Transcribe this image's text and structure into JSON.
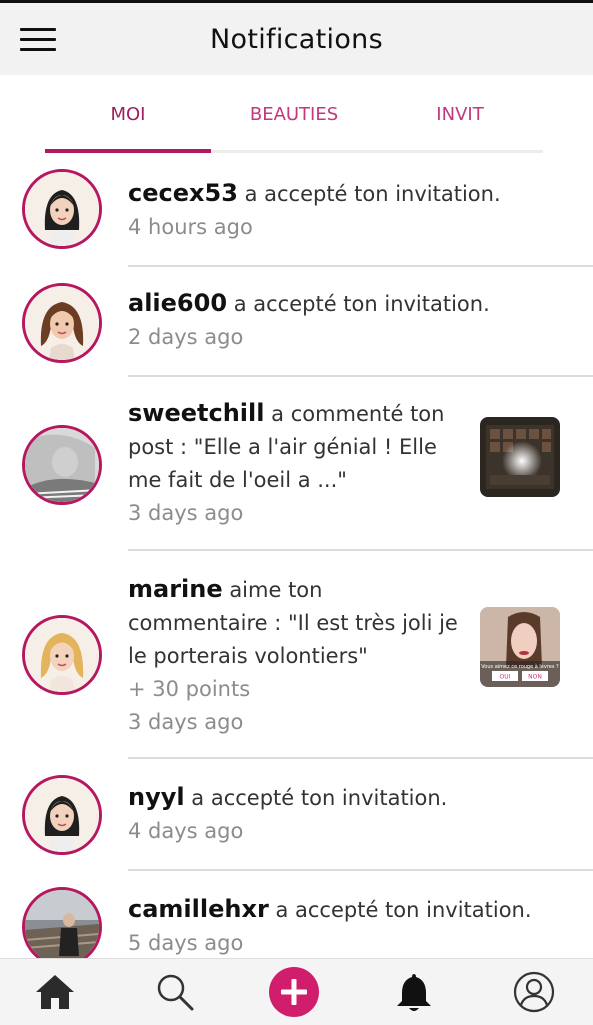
{
  "header": {
    "title": "Notifications",
    "menu_icon": "hamburger-menu-icon"
  },
  "tabs": [
    {
      "label": "MOI",
      "active": true
    },
    {
      "label": "BEAUTIES",
      "active": false
    },
    {
      "label": "INVIT",
      "active": false
    }
  ],
  "notifications": [
    {
      "user": "cecex53",
      "text": " a accepté ton invitation.",
      "time": "4 hours ago",
      "avatar": "cartoon-girl-dark-hair"
    },
    {
      "user": "alie600",
      "text": " a accepté ton invitation.",
      "time": "2 days ago",
      "avatar": "cartoon-girl-brown-curly-hair"
    },
    {
      "user": "sweetchill",
      "text": " a commenté ton post : \"Elle a l'air génial ! Elle me fait de l'oeil a ...\"",
      "time": "3 days ago",
      "avatar": "photo-woman",
      "thumbnail": "eyeshadow-palette-photo"
    },
    {
      "user": "marine",
      "text": " aime ton commentaire : \"Il est très joli je le porterais volontiers\"",
      "points": "+ 30 points",
      "time": "3 days ago",
      "avatar": "cartoon-girl-blonde-hair",
      "thumbnail": "lipstick-poll-photo",
      "thumbnail_text": {
        "question": "Vous aimez ce rouge à lèvres ?",
        "yes": "OUI",
        "no": "NON"
      }
    },
    {
      "user": "nyyl",
      "text": " a accepté ton invitation.",
      "time": "4 days ago",
      "avatar": "cartoon-girl-dark-hair"
    },
    {
      "user": "camillehxr",
      "text": " a accepté ton invitation.",
      "time": "5 days ago",
      "avatar": "photo-person-outdoor"
    }
  ],
  "bottom_nav": [
    {
      "icon": "home-icon"
    },
    {
      "icon": "search-icon"
    },
    {
      "icon": "add-icon"
    },
    {
      "icon": "bell-icon"
    },
    {
      "icon": "profile-icon"
    }
  ],
  "colors": {
    "accent": "#b5185f",
    "tab_text": "#c2377e",
    "muted": "#8c8c8c"
  }
}
